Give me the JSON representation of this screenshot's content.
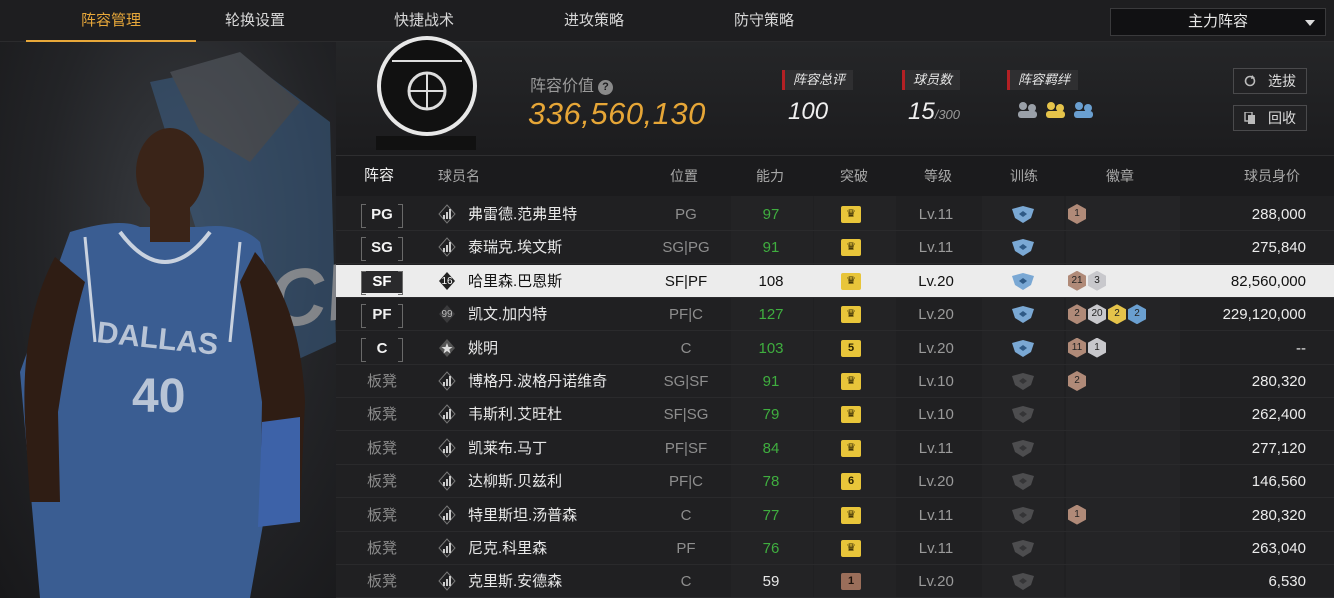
{
  "nav": {
    "tabs": [
      "阵容管理",
      "轮换设置",
      "快捷战术",
      "进攻策略",
      "防守策略"
    ],
    "active_tab": 0,
    "lineup_select": "主力阵容"
  },
  "summary": {
    "value_label": "阵容价值",
    "value": "336,560,130",
    "rating_label": "阵容总评",
    "rating": "100",
    "players_label": "球员数",
    "players": "15",
    "players_max": "/300",
    "bond_label": "阵容羁绊",
    "scout_button": "选拔",
    "recycle_button": "回收"
  },
  "table": {
    "headers": [
      "阵容",
      "球员名",
      "位置",
      "能力",
      "突破",
      "等级",
      "训练",
      "徽章",
      "球员身价"
    ],
    "rows": [
      {
        "slot": "PG",
        "badge": "bars",
        "name": "弗雷德.范弗里特",
        "position": "PG",
        "ability": "97",
        "ability_color": "green",
        "break": "crown",
        "level": "Lv.11",
        "train": "blue",
        "medals": [
          {
            "t": "br",
            "n": "1"
          }
        ],
        "price": "288,000",
        "selected": false,
        "bench": false
      },
      {
        "slot": "SG",
        "badge": "bars",
        "name": "泰瑞克.埃文斯",
        "position": "SG|PG",
        "ability": "91",
        "ability_color": "green",
        "break": "crown",
        "level": "Lv.11",
        "train": "blue",
        "medals": [],
        "price": "275,840",
        "selected": false,
        "bench": false
      },
      {
        "slot": "SF",
        "badge": "16",
        "name": "哈里森.巴恩斯",
        "position": "SF|PF",
        "ability": "108",
        "ability_color": "white",
        "break": "crown",
        "level": "Lv.20",
        "train": "blue",
        "medals": [
          {
            "t": "br",
            "n": "21"
          },
          {
            "t": "si",
            "n": "3"
          }
        ],
        "price": "82,560,000",
        "selected": true,
        "bench": false
      },
      {
        "slot": "PF",
        "badge": "99",
        "name": "凯文.加内特",
        "position": "PF|C",
        "ability": "127",
        "ability_color": "green",
        "break": "crown",
        "level": "Lv.20",
        "train": "blue",
        "medals": [
          {
            "t": "br",
            "n": "2"
          },
          {
            "t": "si",
            "n": "20"
          },
          {
            "t": "go",
            "n": "2"
          },
          {
            "t": "bl",
            "n": "2"
          }
        ],
        "price": "229,120,000",
        "selected": false,
        "bench": false
      },
      {
        "slot": "C",
        "badge": "star",
        "name": "姚明",
        "position": "C",
        "ability": "103",
        "ability_color": "green",
        "break": "5",
        "level": "Lv.20",
        "train": "blue",
        "medals": [
          {
            "t": "br",
            "n": "11"
          },
          {
            "t": "si",
            "n": "1"
          }
        ],
        "price": "--",
        "selected": false,
        "bench": false
      },
      {
        "slot": "板凳",
        "badge": "bars",
        "name": "博格丹.波格丹诺维奇",
        "position": "SG|SF",
        "ability": "91",
        "ability_color": "green",
        "break": "crown",
        "level": "Lv.10",
        "train": "gray",
        "medals": [
          {
            "t": "br",
            "n": "2"
          }
        ],
        "price": "280,320",
        "selected": false,
        "bench": true
      },
      {
        "slot": "板凳",
        "badge": "bars",
        "name": "韦斯利.艾旺杜",
        "position": "SF|SG",
        "ability": "79",
        "ability_color": "green",
        "break": "crown",
        "level": "Lv.10",
        "train": "gray",
        "medals": [],
        "price": "262,400",
        "selected": false,
        "bench": true
      },
      {
        "slot": "板凳",
        "badge": "bars",
        "name": "凯莱布.马丁",
        "position": "PF|SF",
        "ability": "84",
        "ability_color": "green",
        "break": "crown",
        "level": "Lv.11",
        "train": "gray",
        "medals": [],
        "price": "277,120",
        "selected": false,
        "bench": true
      },
      {
        "slot": "板凳",
        "badge": "bars",
        "name": "达柳斯.贝兹利",
        "position": "PF|C",
        "ability": "78",
        "ability_color": "green",
        "break": "6",
        "level": "Lv.20",
        "train": "gray",
        "medals": [],
        "price": "146,560",
        "selected": false,
        "bench": true
      },
      {
        "slot": "板凳",
        "badge": "bars",
        "name": "特里斯坦.汤普森",
        "position": "C",
        "ability": "77",
        "ability_color": "green",
        "break": "crown",
        "level": "Lv.11",
        "train": "gray",
        "medals": [
          {
            "t": "br",
            "n": "1"
          }
        ],
        "price": "280,320",
        "selected": false,
        "bench": true
      },
      {
        "slot": "板凳",
        "badge": "bars",
        "name": "尼克.科里森",
        "position": "PF",
        "ability": "76",
        "ability_color": "green",
        "break": "crown",
        "level": "Lv.11",
        "train": "gray",
        "medals": [],
        "price": "263,040",
        "selected": false,
        "bench": true
      },
      {
        "slot": "板凳",
        "badge": "bars",
        "name": "克里斯.安德森",
        "position": "C",
        "ability": "59",
        "ability_color": "white",
        "break": "1b",
        "level": "Lv.20",
        "train": "gray",
        "medals": [],
        "price": "6,530",
        "selected": false,
        "bench": true
      }
    ]
  },
  "jersey": {
    "team": "DALLAS",
    "number": "40"
  },
  "colors": {
    "accent": "#e8a83a",
    "value": "#e6a637",
    "green": "#3fae3f",
    "red_marker": "#b32024"
  }
}
